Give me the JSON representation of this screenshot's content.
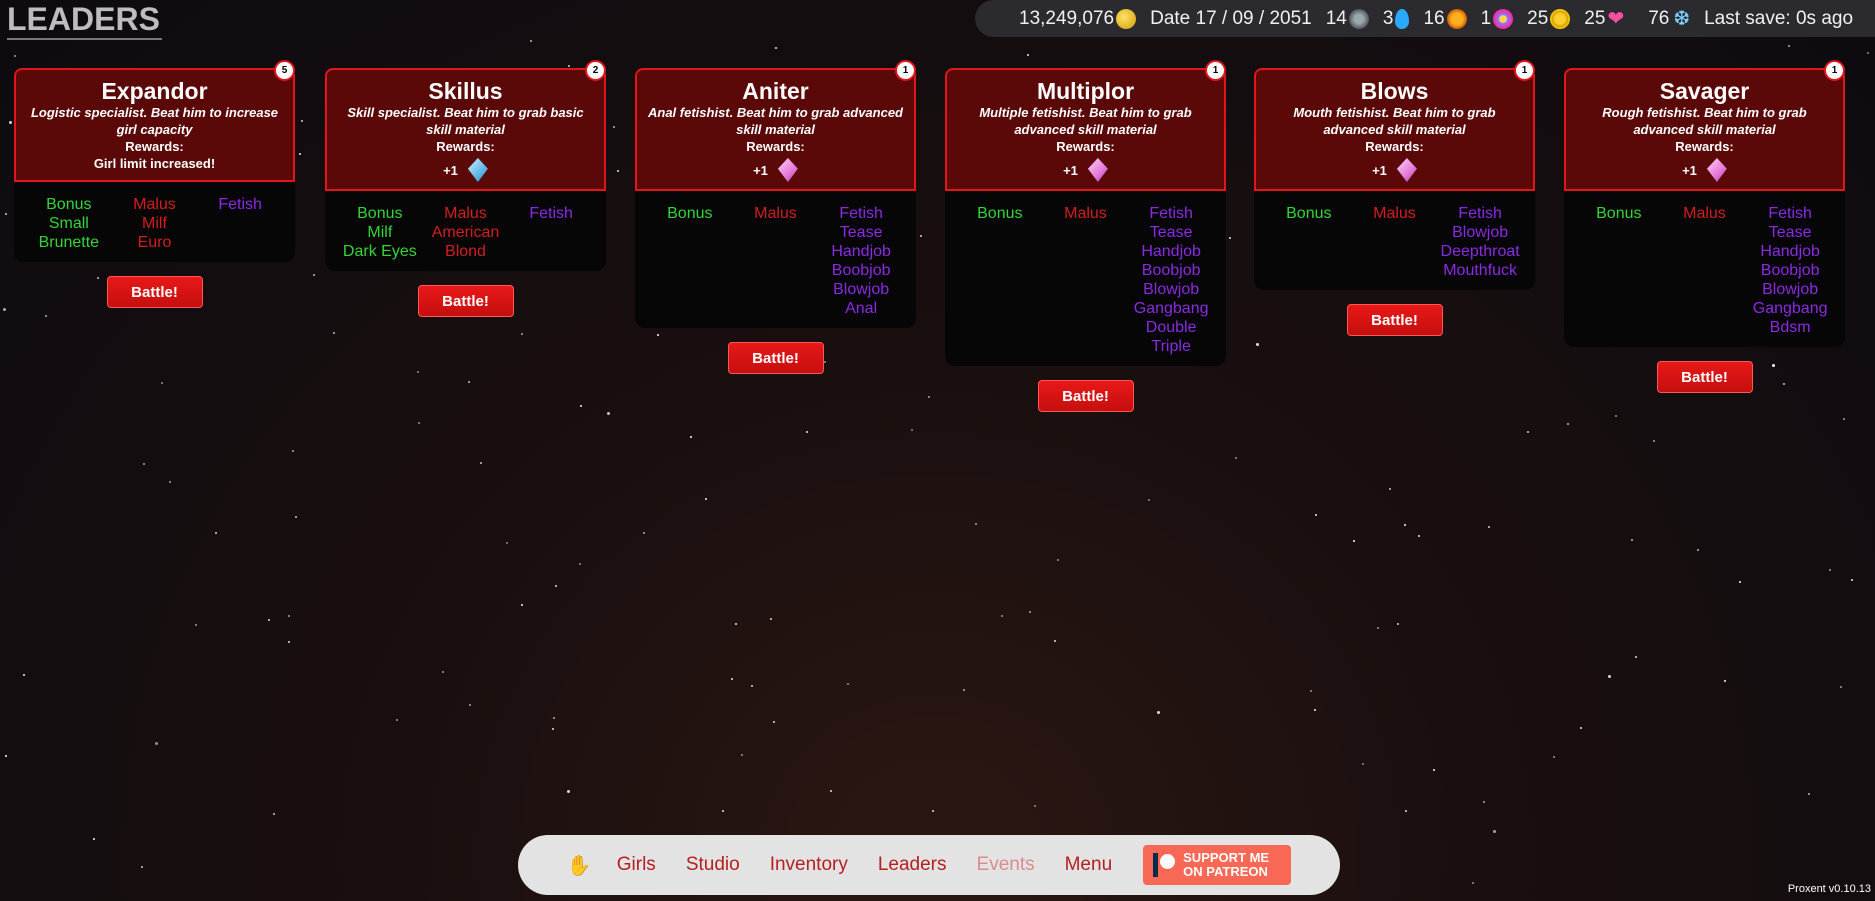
{
  "page_title": "LEADERS",
  "topbar": {
    "money": "13,249,076",
    "date": "Date 17 / 09 / 2051",
    "res_gear": "14",
    "res_drop": "3",
    "res_sun": "16",
    "res_flower": "1",
    "res_gold": "25",
    "res_heart": "25",
    "res_splash": "76",
    "last_save": "Last save: 0s ago",
    "icons": [
      "coin-icon",
      "gear-icon",
      "drop-icon",
      "sun-icon",
      "flower-icon",
      "gold-icon",
      "heart-icon",
      "splash-icon"
    ]
  },
  "leaders": [
    {
      "name": "Expandor",
      "desc": "Logistic specialist. Beat him to increase girl capacity",
      "rewards_label": "Rewards:",
      "reward_text": "Girl limit increased!",
      "badge": "5",
      "bonus": [
        "Bonus",
        "Small",
        "Brunette"
      ],
      "malus": [
        "Malus",
        "Milf",
        "Euro"
      ],
      "fetish": [
        "Fetish"
      ],
      "battle": "Battle!"
    },
    {
      "name": "Skillus",
      "desc": "Skill specialist. Beat him to grab basic skill material",
      "rewards_label": "Rewards:",
      "reward_amount": "+1",
      "reward_icon": "blue-crystal-icon",
      "badge": "2",
      "bonus": [
        "Bonus",
        "Milf",
        "Dark Eyes"
      ],
      "malus": [
        "Malus",
        "American",
        "Blond"
      ],
      "fetish": [
        "Fetish"
      ],
      "battle": "Battle!"
    },
    {
      "name": "Aniter",
      "desc": "Anal fetishist. Beat him to grab advanced skill material",
      "rewards_label": "Rewards:",
      "reward_amount": "+1",
      "reward_icon": "pink-crystal-icon",
      "badge": "1",
      "bonus": [
        "Bonus"
      ],
      "malus": [
        "Malus"
      ],
      "fetish": [
        "Fetish",
        "Tease",
        "Handjob",
        "Boobjob",
        "Blowjob",
        "Anal"
      ],
      "battle": "Battle!"
    },
    {
      "name": "Multiplor",
      "desc": "Multiple fetishist. Beat him to grab advanced skill material",
      "rewards_label": "Rewards:",
      "reward_amount": "+1",
      "reward_icon": "pink-crystal-icon",
      "badge": "1",
      "bonus": [
        "Bonus"
      ],
      "malus": [
        "Malus"
      ],
      "fetish": [
        "Fetish",
        "Tease",
        "Handjob",
        "Boobjob",
        "Blowjob",
        "Gangbang",
        "Double",
        "Triple"
      ],
      "battle": "Battle!"
    },
    {
      "name": "Blows",
      "desc": "Mouth fetishist. Beat him to grab advanced skill material",
      "rewards_label": "Rewards:",
      "reward_amount": "+1",
      "reward_icon": "pink-crystal-icon",
      "badge": "1",
      "bonus": [
        "Bonus"
      ],
      "malus": [
        "Malus"
      ],
      "fetish": [
        "Fetish",
        "Blowjob",
        "Deepthroat",
        "Mouthfuck"
      ],
      "battle": "Battle!"
    },
    {
      "name": "Savager",
      "desc": "Rough fetishist. Beat him to grab advanced skill material",
      "rewards_label": "Rewards:",
      "reward_amount": "+1",
      "reward_icon": "pink-crystal-icon",
      "badge": "1",
      "bonus": [
        "Bonus"
      ],
      "malus": [
        "Malus"
      ],
      "fetish": [
        "Fetish",
        "Tease",
        "Handjob",
        "Boobjob",
        "Blowjob",
        "Gangbang",
        "Bdsm"
      ],
      "battle": "Battle!"
    }
  ],
  "nav": {
    "home_icon": "hand-icon",
    "girls": "Girls",
    "studio": "Studio",
    "inventory": "Inventory",
    "leaders": "Leaders",
    "events": "Events",
    "menu": "Menu",
    "patreon_line1": "SUPPORT ME",
    "patreon_line2": "ON PATREON"
  },
  "version": "Proxent v0.10.13",
  "colors": {
    "header_bg": "#5a0808",
    "header_border": "#e0161a",
    "bonus": "#35d438",
    "malus": "#d21e1e",
    "fetish": "#8a2be2",
    "patreon": "#f96854"
  }
}
